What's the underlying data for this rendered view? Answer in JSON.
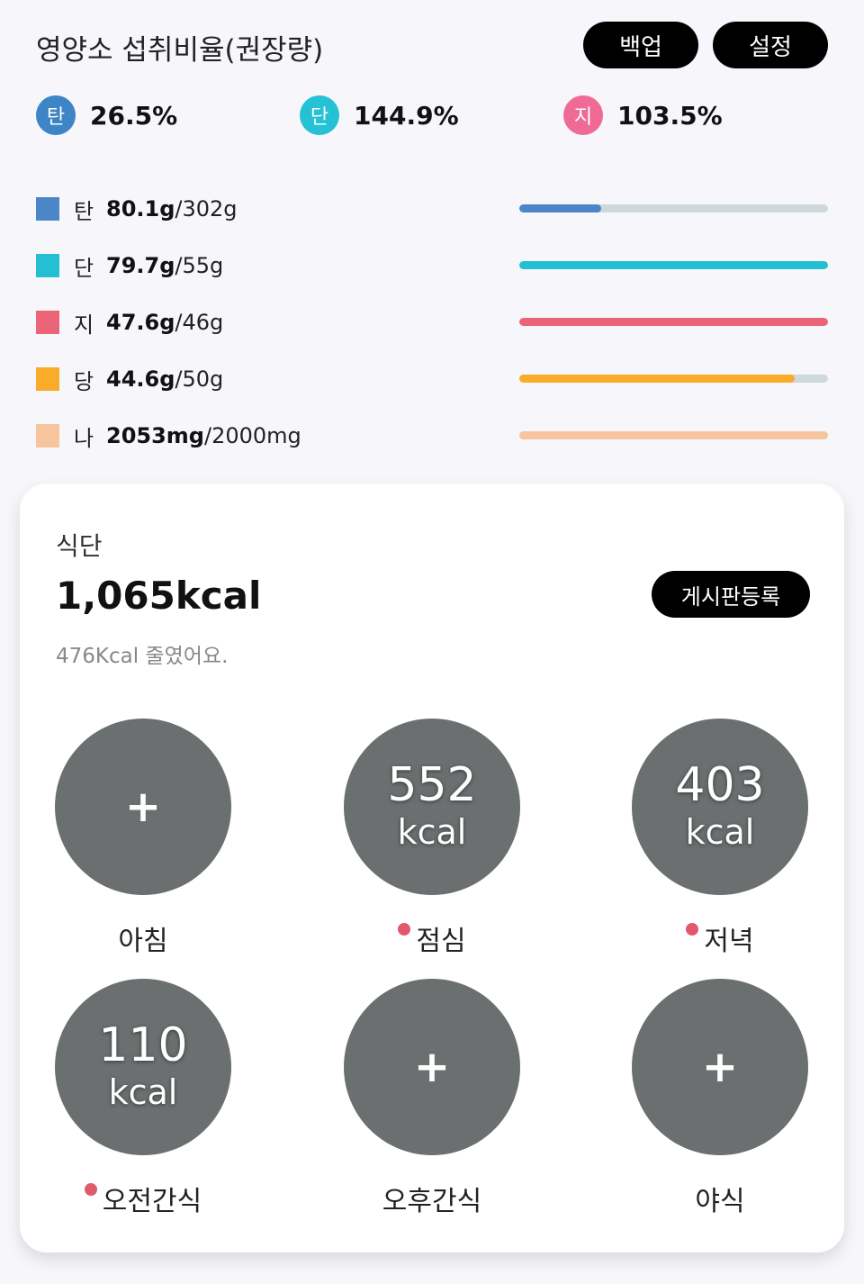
{
  "header": {
    "title": "영양소 섭취비율(권장량)",
    "backup_label": "백업",
    "settings_label": "설정"
  },
  "ratios": [
    {
      "badge": "탄",
      "value": "26.5%",
      "color": "#3d85c6"
    },
    {
      "badge": "단",
      "value": "144.9%",
      "color": "#25c2d6"
    },
    {
      "badge": "지",
      "value": "103.5%",
      "color": "#ef6b96"
    }
  ],
  "nutrients": [
    {
      "label": "탄",
      "value": "80.1g",
      "goal": "/302g",
      "color": "#4a86c8",
      "fill": 0.265
    },
    {
      "label": "단",
      "value": "79.7g",
      "goal": "/55g",
      "color": "#25bfd4",
      "fill": 1.0
    },
    {
      "label": "지",
      "value": "47.6g",
      "goal": "/46g",
      "color": "#ec6478",
      "fill": 1.0
    },
    {
      "label": "당",
      "value": "44.6g",
      "goal": "/50g",
      "color": "#f8ac2a",
      "fill": 0.892
    },
    {
      "label": "나",
      "value": "2053mg",
      "goal": "/2000mg",
      "color": "#f6c59e",
      "fill": 1.0
    }
  ],
  "diet": {
    "label": "식단",
    "total_kcal": "1,065kcal",
    "subtitle": "476Kcal 줄였어요.",
    "board_label": "게시판등록"
  },
  "meals": [
    {
      "name": "아침",
      "kcal": "",
      "unit": "",
      "has_photo": false,
      "dot": false,
      "plus": "+"
    },
    {
      "name": "점심",
      "kcal": "552",
      "unit": "kcal",
      "has_photo": true,
      "dot": true,
      "plus": ""
    },
    {
      "name": "저녁",
      "kcal": "403",
      "unit": "kcal",
      "has_photo": true,
      "dot": true,
      "plus": ""
    },
    {
      "name": "오전간식",
      "kcal": "110",
      "unit": "kcal",
      "has_photo": true,
      "dot": true,
      "plus": ""
    },
    {
      "name": "오후간식",
      "kcal": "",
      "unit": "",
      "has_photo": false,
      "dot": false,
      "plus": "+"
    },
    {
      "name": "야식",
      "kcal": "",
      "unit": "",
      "has_photo": false,
      "dot": false,
      "plus": "+"
    }
  ]
}
